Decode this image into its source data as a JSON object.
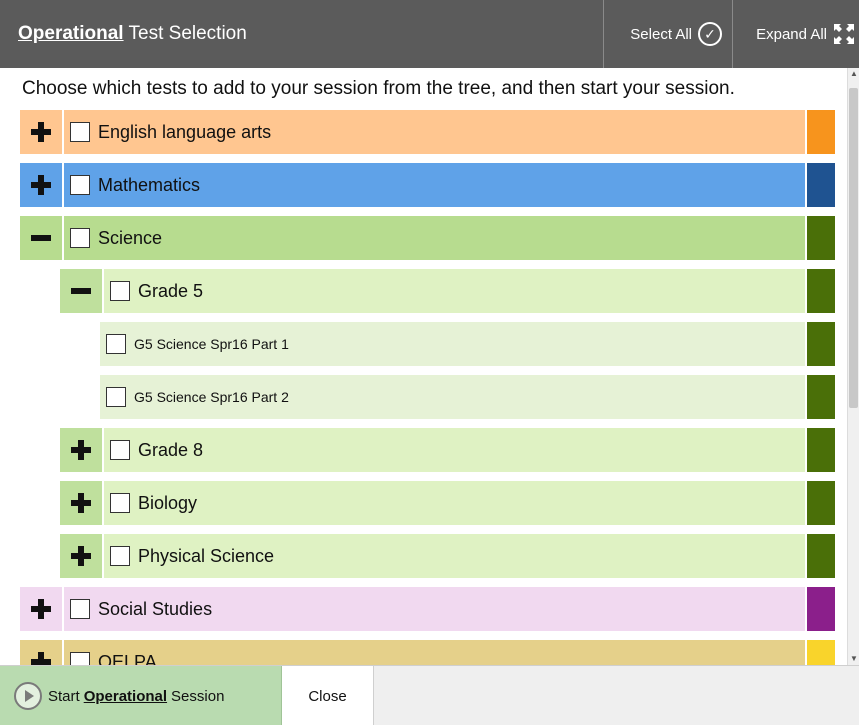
{
  "header": {
    "title_prefix": "Operational",
    "title_suffix": "Test Selection",
    "select_all_label": "Select All",
    "expand_all_label": "Expand All"
  },
  "instructions": "Choose which tests to add to your session from the tree, and then start your session.",
  "tree": [
    {
      "label": "English language arts",
      "level": 0,
      "expander": "plus",
      "row_color": "#ffc690",
      "expander_color": "#ffc690",
      "bar_color": "#f7941d"
    },
    {
      "label": "Mathematics",
      "level": 0,
      "expander": "plus",
      "row_color": "#5fa2e8",
      "expander_color": "#5fa2e8",
      "bar_color": "#1f5391"
    },
    {
      "label": "Science",
      "level": 0,
      "expander": "minus",
      "row_color": "#b7dc8f",
      "expander_color": "#b7dc8f",
      "bar_color": "#4a6f08"
    },
    {
      "label": "Grade 5",
      "level": 1,
      "expander": "minus",
      "row_color": "#dff2c3",
      "expander_color": "#bfe09d",
      "bar_color": "#4a6f08"
    },
    {
      "label": "G5 Science Spr16 Part 1",
      "level": 2,
      "expander": "none",
      "row_color": "#e6f2d6",
      "bar_color": "#4a6f08"
    },
    {
      "label": "G5 Science Spr16 Part 2",
      "level": 2,
      "expander": "none",
      "row_color": "#e6f2d6",
      "bar_color": "#4a6f08"
    },
    {
      "label": "Grade 8",
      "level": 1,
      "expander": "plus",
      "row_color": "#dff2c3",
      "expander_color": "#bfe09d",
      "bar_color": "#4a6f08"
    },
    {
      "label": "Biology",
      "level": 1,
      "expander": "plus",
      "row_color": "#dff2c3",
      "expander_color": "#bfe09d",
      "bar_color": "#4a6f08"
    },
    {
      "label": "Physical Science",
      "level": 1,
      "expander": "plus",
      "row_color": "#dff2c3",
      "expander_color": "#bfe09d",
      "bar_color": "#4a6f08"
    },
    {
      "label": "Social Studies",
      "level": 0,
      "expander": "plus",
      "row_color": "#f1d9f0",
      "expander_color": "#f1d9f0",
      "bar_color": "#8b1f8b"
    },
    {
      "label": "OELPA",
      "level": 0,
      "expander": "plus",
      "row_color": "#e5d08a",
      "expander_color": "#e5d08a",
      "bar_color": "#f9d42b"
    }
  ],
  "footer": {
    "start_prefix": "Start",
    "start_bold": "Operational",
    "start_suffix": "Session",
    "close_label": "Close"
  }
}
